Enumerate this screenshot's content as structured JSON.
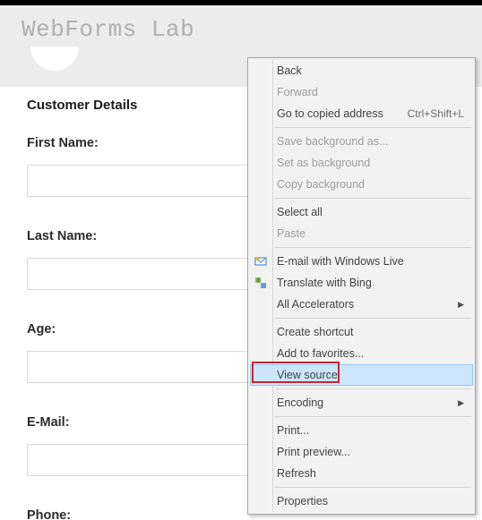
{
  "header": {
    "site_title": "WebForms Lab"
  },
  "section": {
    "heading": "Customer Details"
  },
  "fields": {
    "first_name": {
      "label": "First Name:",
      "value": ""
    },
    "last_name": {
      "label": "Last Name:",
      "value": ""
    },
    "age": {
      "label": "Age:",
      "value": ""
    },
    "email": {
      "label": "E-Mail:",
      "value": ""
    },
    "phone": {
      "label": "Phone:",
      "value": ""
    }
  },
  "menu": {
    "back": {
      "label": "Back"
    },
    "forward": {
      "label": "Forward"
    },
    "go_copied": {
      "label": "Go to copied address",
      "shortcut": "Ctrl+Shift+L"
    },
    "save_bg": {
      "label": "Save background as..."
    },
    "set_bg": {
      "label": "Set as background"
    },
    "copy_bg": {
      "label": "Copy background"
    },
    "select_all": {
      "label": "Select all"
    },
    "paste": {
      "label": "Paste"
    },
    "email_live": {
      "label": "E-mail with Windows Live"
    },
    "translate_bing": {
      "label": "Translate with Bing"
    },
    "all_accel": {
      "label": "All Accelerators"
    },
    "create_shortcut": {
      "label": "Create shortcut"
    },
    "add_favorites": {
      "label": "Add to favorites..."
    },
    "view_source": {
      "label": "View source"
    },
    "encoding": {
      "label": "Encoding"
    },
    "print": {
      "label": "Print..."
    },
    "print_preview": {
      "label": "Print preview..."
    },
    "refresh": {
      "label": "Refresh"
    },
    "properties": {
      "label": "Properties"
    }
  }
}
